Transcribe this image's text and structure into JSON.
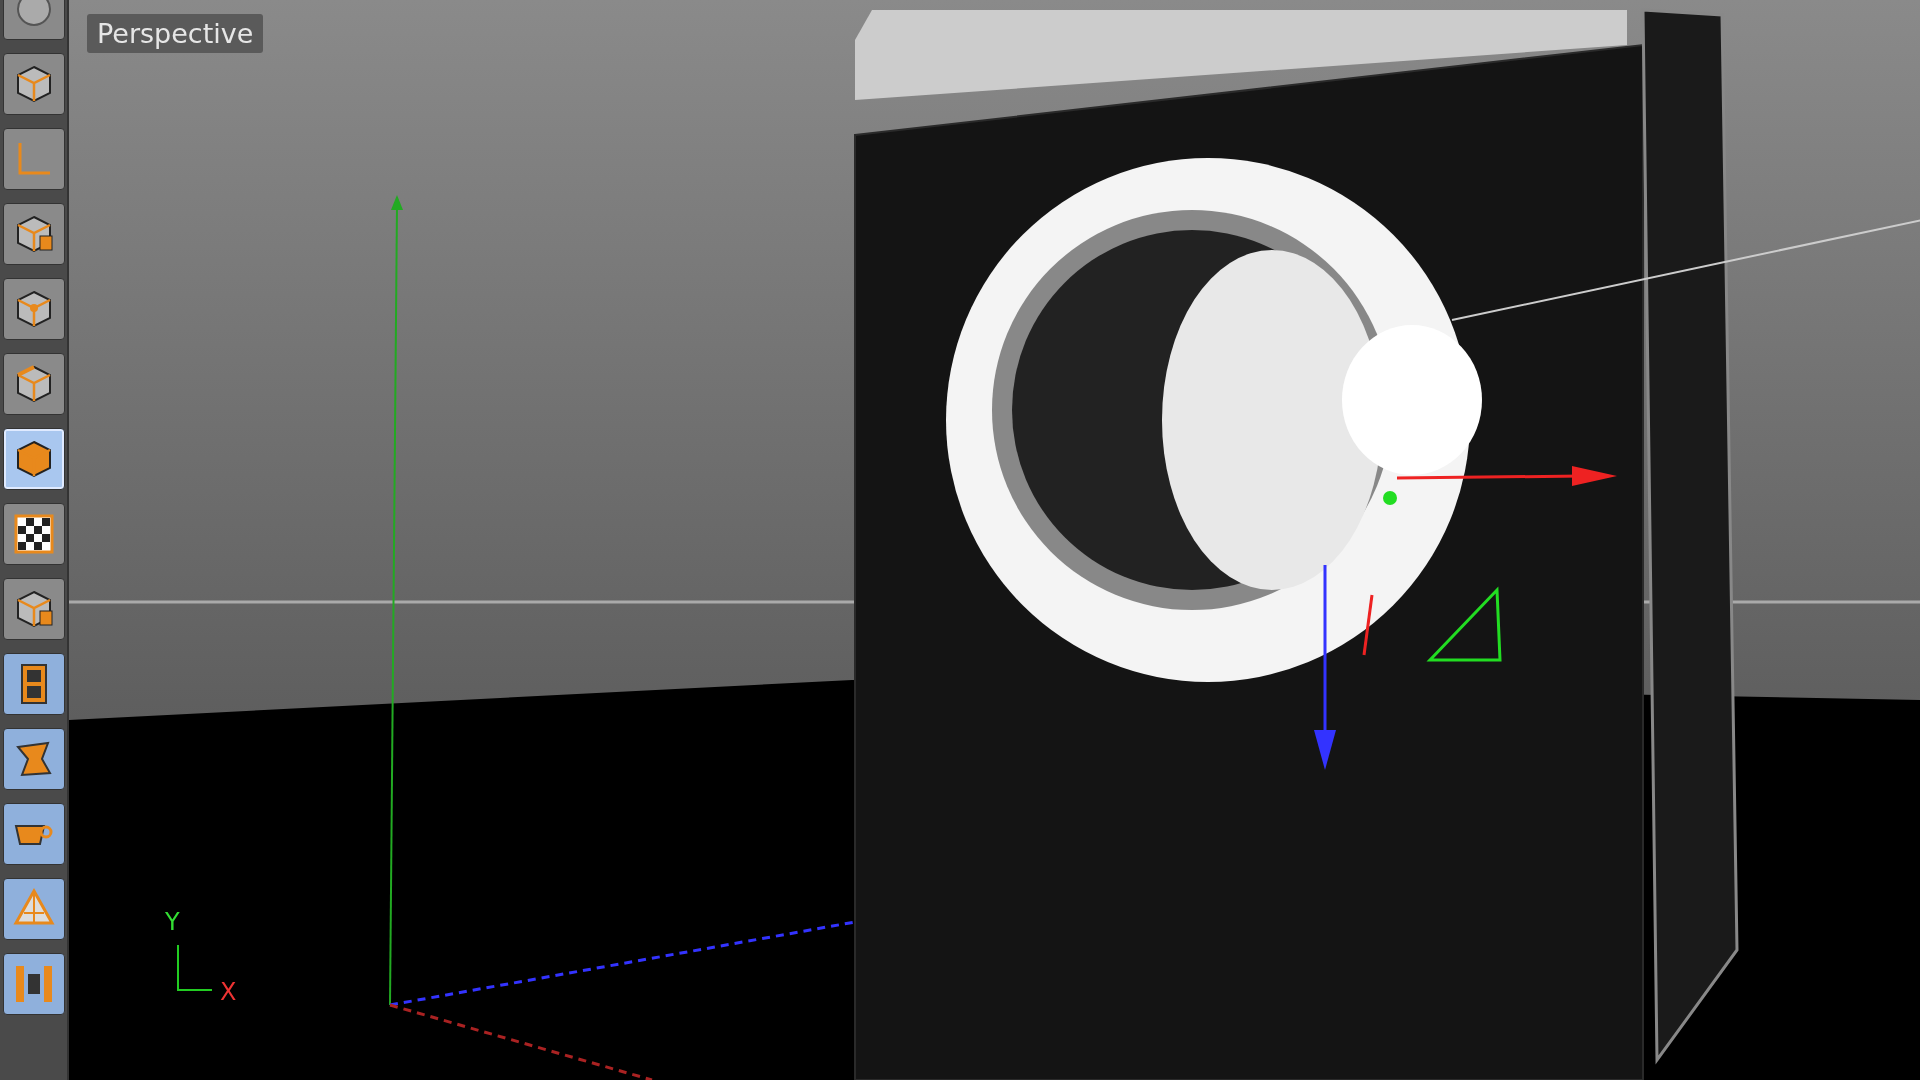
{
  "toolbar": {
    "items": [
      {
        "kind": "sphere",
        "selected": false,
        "tinted": false
      },
      {
        "kind": "cube",
        "selected": false,
        "tinted": false
      },
      {
        "kind": "axis",
        "selected": false,
        "tinted": false
      },
      {
        "kind": "cube-lock",
        "selected": false,
        "tinted": false
      },
      {
        "kind": "cube-point",
        "selected": false,
        "tinted": false
      },
      {
        "kind": "cube-edge",
        "selected": false,
        "tinted": false
      },
      {
        "kind": "cube-solid",
        "selected": true,
        "tinted": true
      },
      {
        "kind": "checker",
        "selected": false,
        "tinted": false
      },
      {
        "kind": "cube-lock",
        "selected": false,
        "tinted": false
      },
      {
        "kind": "film",
        "selected": false,
        "tinted": true
      },
      {
        "kind": "twist",
        "selected": false,
        "tinted": true
      },
      {
        "kind": "cup",
        "selected": false,
        "tinted": true
      },
      {
        "kind": "pyramid",
        "selected": false,
        "tinted": true
      },
      {
        "kind": "bars",
        "selected": false,
        "tinted": true
      }
    ]
  },
  "viewport": {
    "title": "Perspective",
    "axis_labels": [
      "Y",
      "X"
    ]
  }
}
